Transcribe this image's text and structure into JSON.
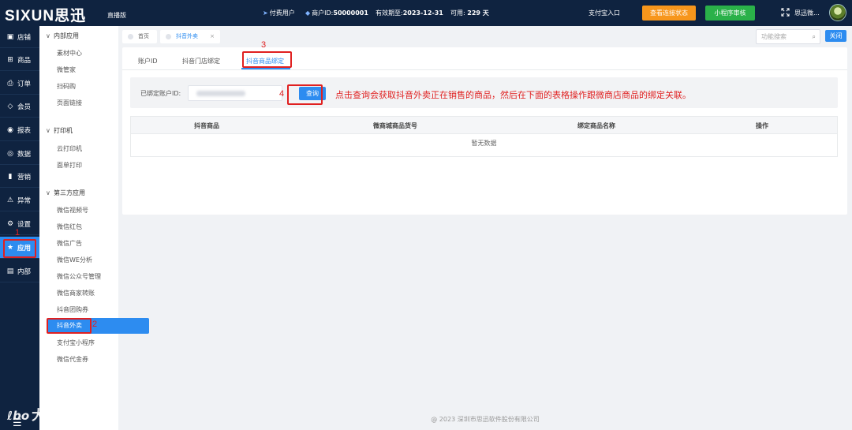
{
  "header": {
    "logo": "SIXUN思迅",
    "edition": "直播版",
    "paid_user": "付费用户",
    "merchant_id_label": "商户ID:",
    "merchant_id": "50000001",
    "valid_until_label": "有效期至:",
    "valid_until": "2023-12-31",
    "available_label": "可用:",
    "available_days": "229 天",
    "alipay_entry": "支付宝入口",
    "check_connection_button": "查看连接状态",
    "mini_program_button": "小程序审核",
    "user_name": "思迅微...",
    "colors": {
      "background": "#0f2340",
      "orange": "#f7961c",
      "green": "#2ab149"
    }
  },
  "leftnav": {
    "items": [
      {
        "icon": "store-icon",
        "label": "店铺"
      },
      {
        "icon": "gift-icon",
        "label": "商品"
      },
      {
        "icon": "order-icon",
        "label": "订单"
      },
      {
        "icon": "member-icon",
        "label": "会员"
      },
      {
        "icon": "report-icon",
        "label": "报表"
      },
      {
        "icon": "data-icon",
        "label": "数据"
      },
      {
        "icon": "marketing-icon",
        "label": "营销"
      },
      {
        "icon": "warning-icon",
        "label": "异常"
      },
      {
        "icon": "gear-icon",
        "label": "设置"
      },
      {
        "icon": "star-icon",
        "label": "应用"
      },
      {
        "icon": "document-icon",
        "label": "内部"
      }
    ],
    "active_index": 9,
    "active_color": "#2d8cf0"
  },
  "submenu": {
    "group1": "内部应用",
    "group1_items": [
      "素材中心",
      "微管家",
      "扫码购",
      "页面链接"
    ],
    "group2": "打印机",
    "group2_items": [
      "云打印机",
      "面单打印"
    ],
    "group3": "第三方应用",
    "group3_items": [
      "微信视频号",
      "微信红包",
      "微信广告",
      "微信WE分析",
      "微信公众号管理",
      "微信商家转账",
      "抖音团购券",
      "抖音外卖",
      "支付宝小程序",
      "微信代金券"
    ],
    "active_item": "抖音外卖"
  },
  "tabs": {
    "home": "首页",
    "current": "抖音外卖",
    "close_x": "×",
    "search_placeholder": "功能搜索",
    "close_button": "关闭"
  },
  "content": {
    "subtabs": [
      "账户ID",
      "抖音门店绑定",
      "抖音商品绑定"
    ],
    "active_subtab": 2,
    "bound_account_label": "已绑定账户ID:",
    "query_button": "查询",
    "hint": "点击查询会获取抖音外卖正在销售的商品，然后在下面的表格操作跟微商店商品的绑定关联。",
    "table_headers": [
      "抖音商品",
      "微商城商品货号",
      "绑定商品名称",
      "操作"
    ],
    "empty_text": "暂无数据"
  },
  "annotations": {
    "n1": "1",
    "n2": "2",
    "n3": "3",
    "n4": "4"
  },
  "footer": "@ 2023 深圳市思迅软件股份有限公司",
  "watermark": "大数跨境"
}
